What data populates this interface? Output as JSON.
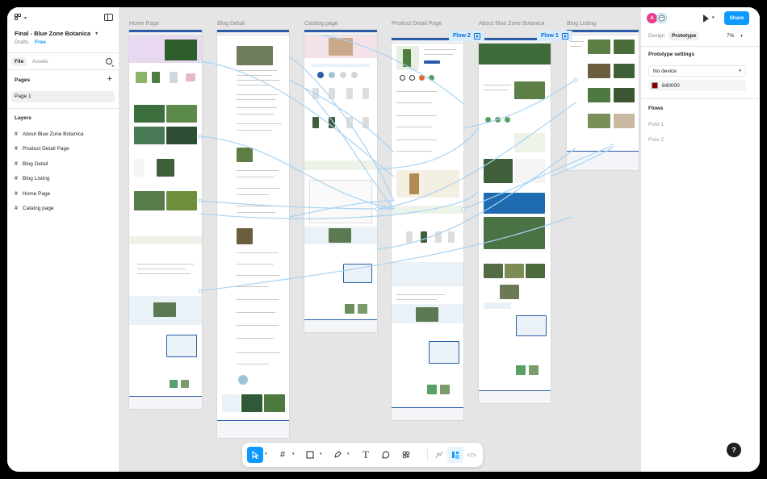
{
  "file": {
    "title": "Final - Blue Zone Botanica",
    "location": "Drafts",
    "plan": "Free"
  },
  "left_tabs": {
    "file": "File",
    "assets": "Assets"
  },
  "pages": {
    "heading": "Pages",
    "items": [
      "Page 1"
    ]
  },
  "layers": {
    "heading": "Layers",
    "items": [
      "About Blue Zone Botanica",
      "Product Detail Page",
      "Blog Detail",
      "Blog Listing",
      "Home Page",
      "Catalog page"
    ]
  },
  "canvas": {
    "frames": [
      "Home Page",
      "Blog Detail",
      "Catalog page",
      "Product Detail Page",
      "About Blue Zone Botanica",
      "Blog Listing"
    ],
    "flow_tags": [
      "Flow 2",
      "Flow 1"
    ]
  },
  "toolbar": {
    "tools": [
      "move-tool",
      "frame-tool",
      "shape-tool",
      "pen-tool",
      "text-tool",
      "comment-tool",
      "actions-tool",
      "draw-mode",
      "design-mode",
      "dev-mode"
    ]
  },
  "right": {
    "avatar_letter": "A",
    "share": "Share",
    "tabs": {
      "design": "Design",
      "prototype": "Prototype"
    },
    "zoom": "7%",
    "settings_heading": "Prototype settings",
    "device": "No device",
    "bg_hex": "840000",
    "flows_heading": "Flows",
    "flows": [
      "Flow 1",
      "Flow 2"
    ]
  },
  "colors": {
    "accent": "#0d99ff",
    "brand_blue": "#2a5da8",
    "swatch": "#840000",
    "avatar": "#e83e8c"
  }
}
